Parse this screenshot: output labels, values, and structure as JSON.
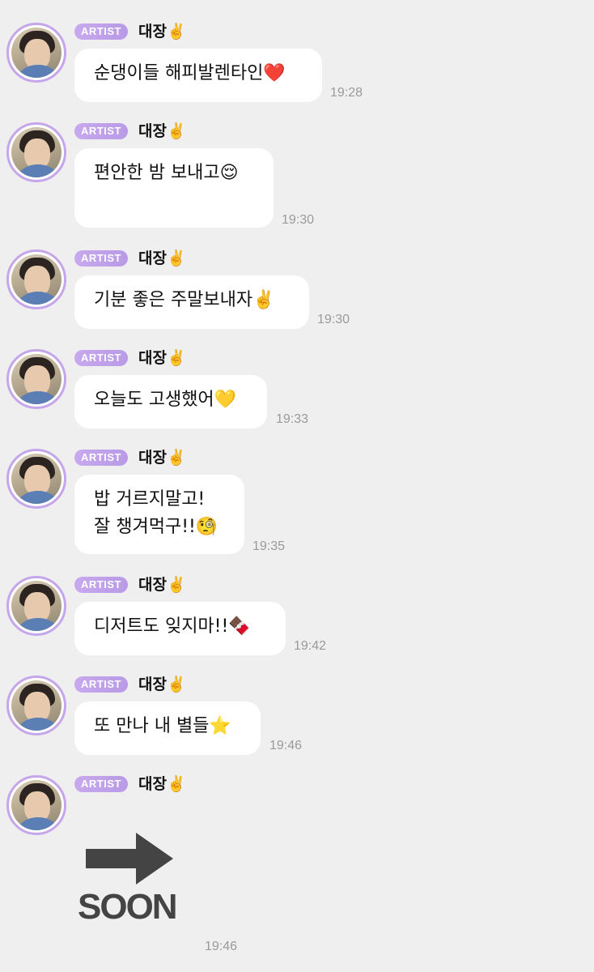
{
  "messages": [
    {
      "badge": "ARTIST",
      "name": "대장✌️",
      "text": "순댕이들 해피발렌타인❤️",
      "time": "19:28"
    },
    {
      "badge": "ARTIST",
      "name": "대장✌️",
      "text": "편안한 밤 보내고😌",
      "time": "19:30"
    },
    {
      "badge": "ARTIST",
      "name": "대장✌️",
      "text": "기분 좋은 주말보내자✌️",
      "time": "19:30"
    },
    {
      "badge": "ARTIST",
      "name": "대장✌️",
      "text": "오늘도 고생했어💛",
      "time": "19:33"
    },
    {
      "badge": "ARTIST",
      "name": "대장✌️",
      "text": "밥 거르지말고!\n잘 챙겨먹구!!🧐",
      "time": "19:35"
    },
    {
      "badge": "ARTIST",
      "name": "대장✌️",
      "text": "디저트도 잊지마!!🍫",
      "time": "19:42"
    },
    {
      "badge": "ARTIST",
      "name": "대장✌️",
      "text": "또 만나 내 별들⭐️",
      "time": "19:46"
    },
    {
      "badge": "ARTIST",
      "name": "대장✌️",
      "image_text": "SOON",
      "time": "19:46"
    }
  ],
  "colors": {
    "background": "#efeff0",
    "badge": "#c3a4ec",
    "bubble": "#ffffff",
    "time": "#9a9a9a"
  },
  "icons": {
    "avatar": "profile-photo",
    "sticker": "right-arrow-icon"
  }
}
